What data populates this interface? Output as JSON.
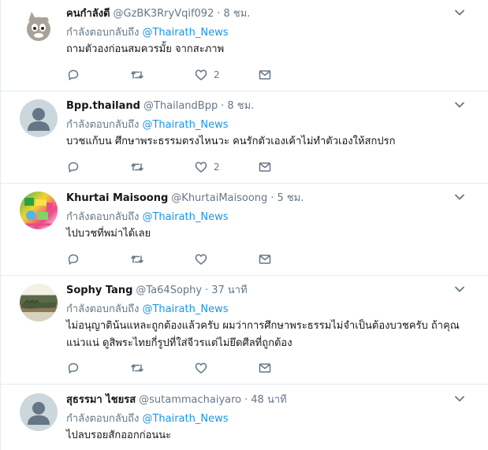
{
  "tweets": [
    {
      "name": "คนกำลังดี",
      "handle": "@GzBK3RryVqif092",
      "time": "8 ชม.",
      "reply_prefix": "กำลังตอบกลับถึง",
      "reply_to": "@Thairath_News",
      "lines": [
        "ถามตัวองก่อนสมควรมั้ย จากสะภาพ"
      ],
      "likes": "2",
      "avatar": "cartoon-cat"
    },
    {
      "name": "Bpp.thailand",
      "handle": "@ThailandBpp",
      "time": "8 ชม.",
      "reply_prefix": "กำลังตอบกลับถึง",
      "reply_to": "@Thairath_News",
      "lines": [
        "บวชแก้บน ศึกษาพระธรรมตรงไหนวะ  คนรักตัวเองเค้าไม่ทำตัวเองให้สกปรก"
      ],
      "likes": "2",
      "avatar": "default"
    },
    {
      "name": "Khurtai Maisoong",
      "handle": "@KhurtaiMaisoong",
      "time": "5 ชม.",
      "reply_prefix": "กำลังตอบกลับถึง",
      "reply_to": "@Thairath_News",
      "lines": [
        "ไปบวชที่พม่าได้เลย"
      ],
      "likes": "",
      "avatar": "colorful-graphic"
    },
    {
      "name": "Sophy Tang",
      "handle": "@Ta64Sophy",
      "time": "37 นาที",
      "reply_prefix": "กำลังตอบกลับถึง",
      "reply_to": "@Thairath_News",
      "lines": [
        "ไม่อนุญาติน้นแหละถูกต้องแล้วครับ ผมว่าการศึกษาพระธรรมไม่จำเป็นต้องบวชครับ ถ้าคุณ",
        "แน่วแน่ ดูสิพระไทยกี่รูปที่ใส่จีวรแต่ไม่ยึดศีลที่ถูกต้อง"
      ],
      "likes": "",
      "avatar": "crocodile-photo"
    },
    {
      "name": "สุธรรมา ไชยรส",
      "handle": "@sutammachaiyaro",
      "time": "48 นาที",
      "reply_prefix": "กำลังตอบกลับถึง",
      "reply_to": "@Thairath_News",
      "lines": [
        "ไปลบรอยสักออกก่อนนะ"
      ],
      "likes": "",
      "avatar": "default"
    }
  ],
  "icons": {
    "reply": "reply-icon",
    "retweet": "retweet-icon",
    "like": "heart-icon",
    "dm": "envelope-icon",
    "more": "chevron-down-icon"
  },
  "colors": {
    "link": "#1b95e0",
    "muted": "#657786",
    "text": "#14171a",
    "divider": "#e6ecf0"
  }
}
